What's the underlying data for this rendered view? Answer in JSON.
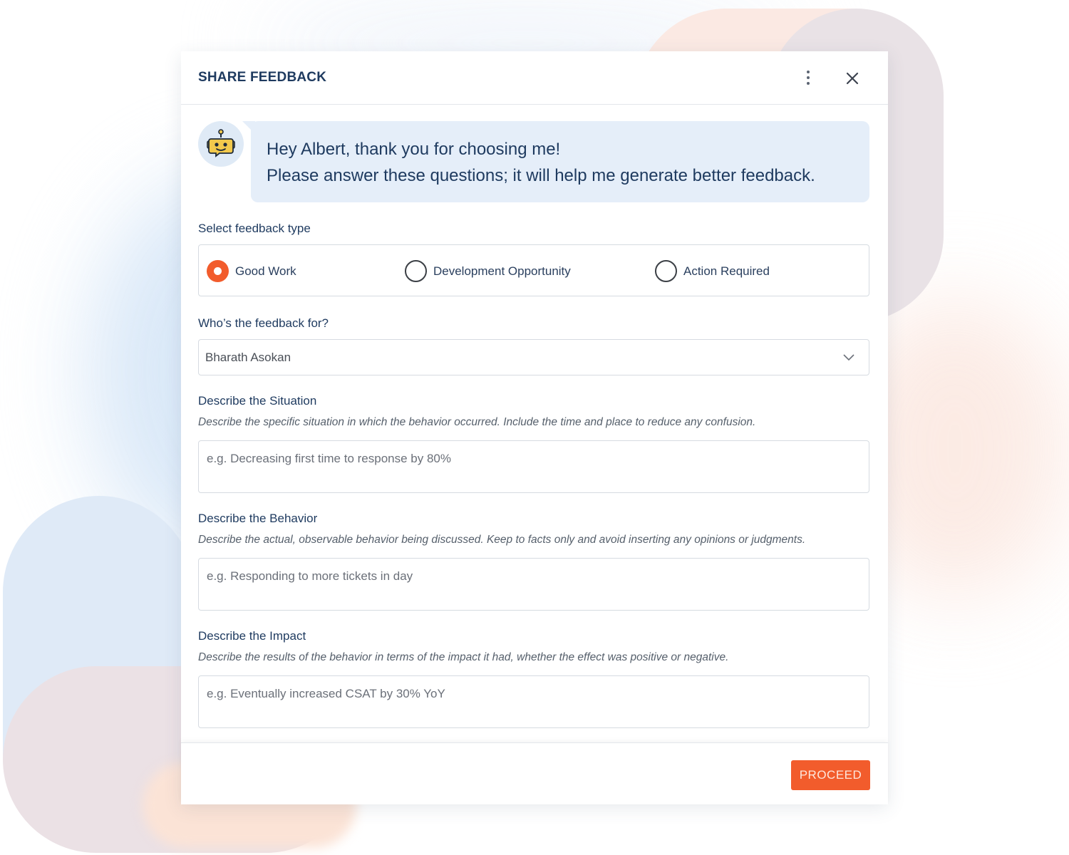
{
  "dialog": {
    "title": "SHARE FEEDBACK",
    "more_icon": "more-vertical-icon",
    "close_icon": "close-icon"
  },
  "bot": {
    "avatar_icon": "robot-icon",
    "greeting": "Hey Albert, thank you for choosing me!",
    "message": "Please answer these questions; it will help me generate better feedback."
  },
  "feedback_type": {
    "label": "Select feedback type",
    "options": [
      {
        "label": "Good Work",
        "selected": true
      },
      {
        "label": "Development Opportunity",
        "selected": false
      },
      {
        "label": "Action Required",
        "selected": false
      }
    ]
  },
  "recipient": {
    "label": "Who’s the feedback for?",
    "value": "Bharath Asokan",
    "chevron_icon": "chevron-down-icon"
  },
  "situation": {
    "label": "Describe the Situation",
    "description": "Describe the specific situation in which the behavior occurred. Include the time and place to reduce any confusion.",
    "placeholder": "e.g. Decreasing first time to response by 80%"
  },
  "behavior": {
    "label": "Describe the Behavior",
    "description": "Describe the actual, observable behavior being discussed. Keep to facts only and avoid inserting any opinions or judgments.",
    "placeholder": "e.g. Responding to more tickets in day"
  },
  "impact": {
    "label": "Describe the Impact",
    "description": "Describe the results of the behavior in terms of the impact it had, whether the effect was positive or negative.",
    "placeholder": "e.g. Eventually increased CSAT by 30% YoY"
  },
  "footer": {
    "proceed_label": "PROCEED"
  },
  "colors": {
    "accent": "#f25c2c",
    "heading": "#1e3a5f",
    "bubble_bg": "#e5eef9"
  }
}
